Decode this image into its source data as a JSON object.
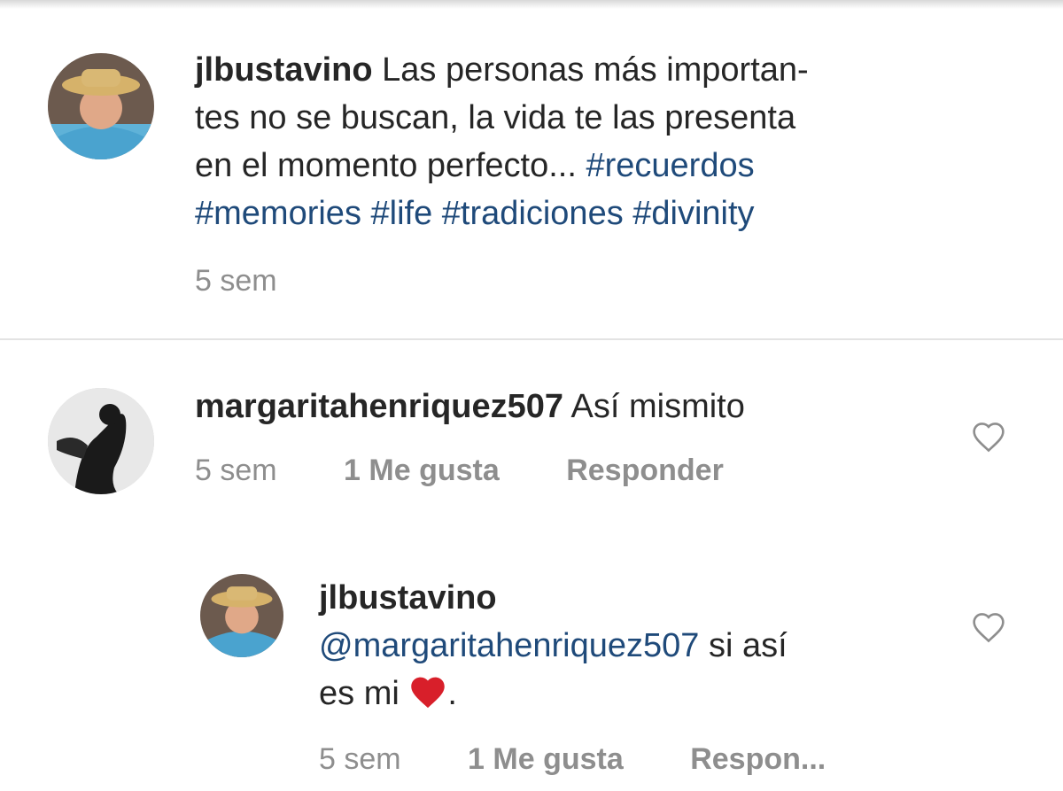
{
  "caption": {
    "username": "jlbustavino",
    "text_lines": [
      "Las personas más importan-",
      "tes no se buscan, la vida te las presenta",
      "en el momento perfecto..."
    ],
    "hashtags": [
      "#recuerdos",
      "#memories",
      "#life",
      "#tradiciones",
      "#divinity"
    ],
    "time": "5 sem"
  },
  "comments": [
    {
      "username": "margaritahenriquez507",
      "text": "Así mismito",
      "time": "5 sem",
      "likes": "1 Me gusta",
      "reply_label": "Responder"
    }
  ],
  "reply": {
    "username": "jlbustavino",
    "mention": "@margaritahenriquez507",
    "text_after_mention": "si así",
    "text_line2": "es mi",
    "text_end": ".",
    "time": "5 sem",
    "likes": "1 Me gusta",
    "reply_label": "Respon..."
  },
  "colors": {
    "hashtag": "#1f4a7a",
    "meta_gray": "#8e8e8e",
    "heart_red": "#d81f2a"
  },
  "icons": [
    "heart-outline-icon",
    "red-heart-emoji"
  ]
}
